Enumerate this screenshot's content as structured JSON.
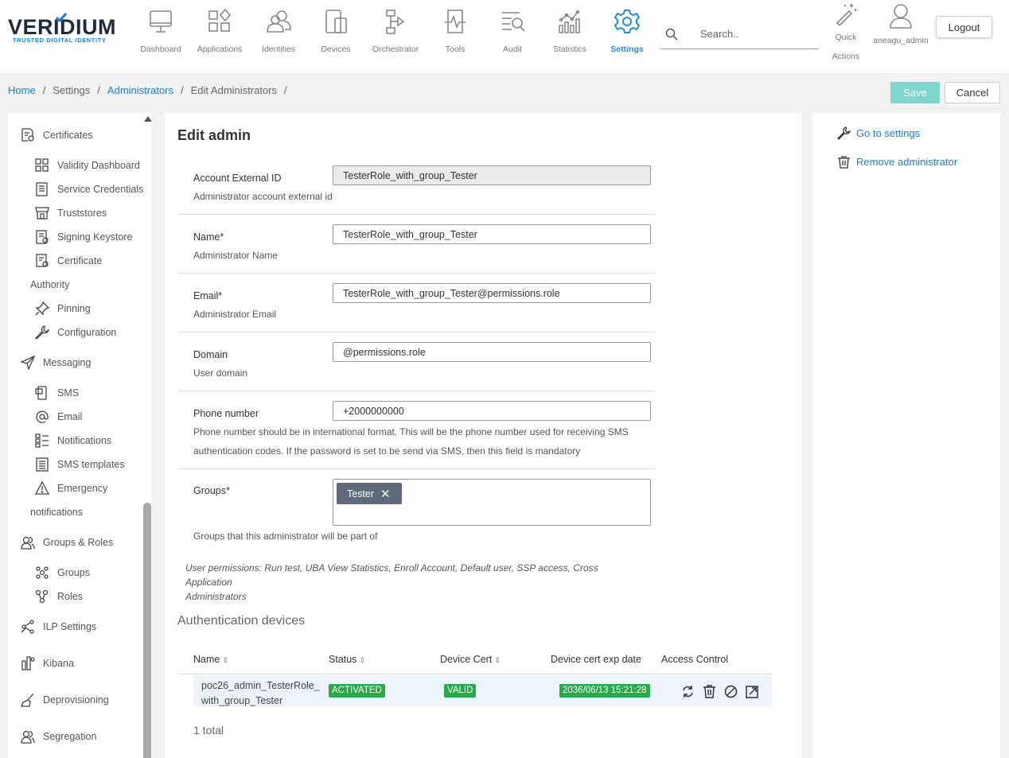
{
  "brand": {
    "name": "VERIDIUM",
    "tagline": "TRUSTED DIGITAL IDENTITY"
  },
  "nav": [
    {
      "label": "Dashboard",
      "icon": "monitor-icon"
    },
    {
      "label": "Applications",
      "icon": "apps-icon"
    },
    {
      "label": "Identities",
      "icon": "identities-icon"
    },
    {
      "label": "Devices",
      "icon": "devices-icon"
    },
    {
      "label": "Orchestrator",
      "icon": "orchestrator-icon"
    },
    {
      "label": "Tools",
      "icon": "tools-icon"
    },
    {
      "label": "Audit",
      "icon": "audit-icon"
    },
    {
      "label": "Statistics",
      "icon": "statistics-icon"
    },
    {
      "label": "Settings",
      "icon": "gear-icon",
      "active": true
    }
  ],
  "search": {
    "placeholder": "Search.."
  },
  "quick_actions": {
    "label_line1": "Quick",
    "label_line2": "Actions"
  },
  "user": {
    "name": "aneagu_admin"
  },
  "logout_label": "Logout",
  "breadcrumb": {
    "home": "Home",
    "settings": "Settings",
    "administrators": "Administrators",
    "edit": "Edit Administrators"
  },
  "actions": {
    "save": "Save",
    "cancel": "Cancel"
  },
  "sidebar": {
    "certificates": "Certificates",
    "validity_dashboard": "Validity Dashboard",
    "service_credentials": "Service Credentials",
    "truststores": "Truststores",
    "signing_keystore": "Signing Keystore",
    "certificate": "Certificate",
    "authority": "Authority",
    "pinning": "Pinning",
    "configuration": "Configuration",
    "messaging": "Messaging",
    "sms": "SMS",
    "email": "Email",
    "notifications": "Notifications",
    "sms_templates": "SMS templates",
    "emergency": "Emergency",
    "emergency_cont": "notifications",
    "groups_roles": "Groups & Roles",
    "groups": "Groups",
    "roles": "Roles",
    "ilp_settings": "ILP Settings",
    "kibana": "Kibana",
    "deprovisioning": "Deprovisioning",
    "segregation": "Segregation"
  },
  "form": {
    "title": "Edit admin",
    "external_id": {
      "label": "Account External ID",
      "help": "Administrator account external id",
      "value": "TesterRole_with_group_Tester"
    },
    "name": {
      "label": "Name*",
      "help": "Administrator Name",
      "value": "TesterRole_with_group_Tester"
    },
    "email": {
      "label": "Email*",
      "help": "Administrator Email",
      "value": "TesterRole_with_group_Tester@permissions.role"
    },
    "domain": {
      "label": "Domain",
      "help": "User domain",
      "value": "@permissions.role"
    },
    "phone": {
      "label": "Phone number",
      "help_line1": "Phone number should be in international format. This will be the phone number used for receiving SMS",
      "help_line2": "authentication codes. If the password is set to be send via SMS, then this field is mandatory",
      "value": "+2000000000"
    },
    "groups": {
      "label": "Groups*",
      "help": "Groups that this administrator will be part of",
      "chips": [
        "Tester"
      ]
    },
    "permissions_line1": "User permissions: Run test, UBA View Statistics, Enroll Account, Default user, SSP access, Cross Application",
    "permissions_line2": "Administrators"
  },
  "auth_devices": {
    "title": "Authentication devices",
    "columns": {
      "name": "Name",
      "status": "Status",
      "device_cert": "Device Cert",
      "exp_date": "Device cert exp date",
      "access_control": "Access Control"
    },
    "rows": [
      {
        "name_line1": "poc26_admin_TesterRole_",
        "name_line2": "with_group_Tester",
        "status": "ACTIVATED",
        "cert": "VALID",
        "exp": "2036/06/13 15:21:28"
      }
    ],
    "total": "1 total"
  },
  "right_panel": {
    "go_to_settings": "Go to settings",
    "remove_admin": "Remove administrator"
  },
  "colors": {
    "accent": "#1a7fd4",
    "save_disabled": "#7ed6cf",
    "badge_green": "#2aa84a",
    "chip": "#5f6b78"
  }
}
